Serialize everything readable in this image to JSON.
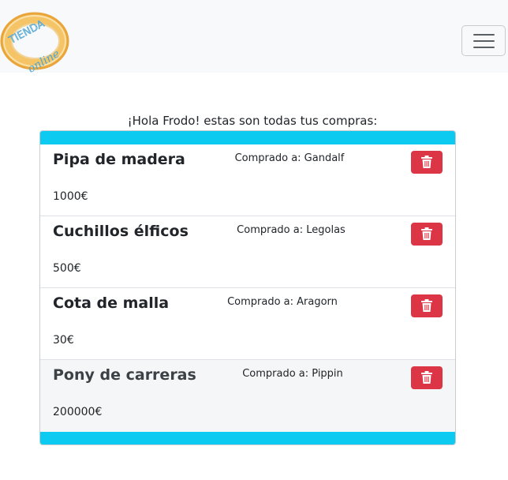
{
  "navbar": {
    "logo": {
      "text_top": "TIENDA",
      "text_bottom": "online",
      "icon": "ring-logo"
    },
    "toggler": {
      "icon": "hamburger-icon"
    }
  },
  "greeting": "¡Hola Frodo! estas son todas tus compras:",
  "purchases": [
    {
      "name": "Pipa de madera",
      "seller": "Comprado a: Gandalf",
      "price": "1000€"
    },
    {
      "name": "Cuchillos élficos",
      "seller": "Comprado a: Legolas",
      "price": "500€"
    },
    {
      "name": "Cota de malla",
      "seller": "Comprado a: Aragorn",
      "price": "30€"
    },
    {
      "name": "Pony de carreras",
      "seller": "Comprado a: Pippin",
      "price": "200000€"
    }
  ],
  "delete_icon": "trash-icon",
  "colors": {
    "accent": "#0dcaf0",
    "danger": "#dc3545",
    "navbar": "#f8f9fa",
    "logo_ring": "#f3b54a"
  }
}
